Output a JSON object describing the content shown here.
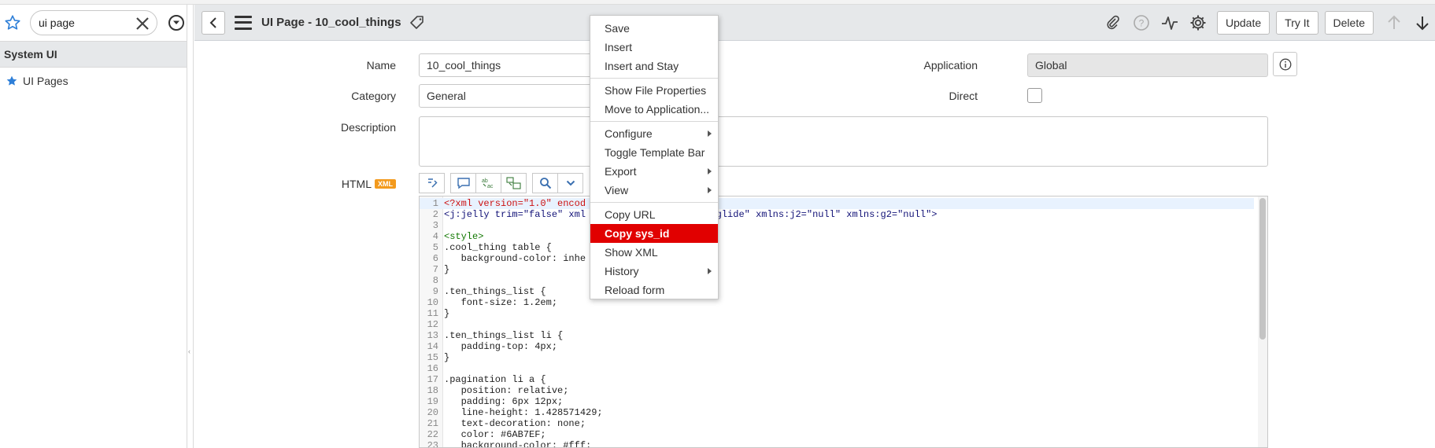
{
  "navigator": {
    "search_value": "ui page",
    "section_title": "System UI",
    "items": [
      {
        "label": "UI Pages"
      }
    ]
  },
  "header": {
    "title": "UI Page - 10_cool_things",
    "buttons": {
      "update": "Update",
      "try_it": "Try It",
      "delete": "Delete"
    }
  },
  "form": {
    "name": {
      "label": "Name",
      "value": "10_cool_things"
    },
    "category": {
      "label": "Category",
      "value": "General"
    },
    "description": {
      "label": "Description",
      "value": ""
    },
    "application": {
      "label": "Application",
      "value": "Global"
    },
    "direct": {
      "label": "Direct",
      "checked": false
    },
    "html": {
      "label": "HTML",
      "badge": "XML"
    }
  },
  "code": {
    "lines": [
      {
        "n": "1",
        "text": "<?xml version=\"1.0\" encod",
        "kind": "xmldecl",
        "active": true
      },
      {
        "n": "2",
        "text": "<j:jelly trim=\"false\" xml                   :g=\"glide\" xmlns:j2=\"null\" xmlns:g2=\"null\">",
        "kind": "jelly"
      },
      {
        "n": "3",
        "text": "",
        "kind": "plain"
      },
      {
        "n": "4",
        "text": "<style>",
        "kind": "tag"
      },
      {
        "n": "5",
        "text": ".cool_thing table {",
        "kind": "plain"
      },
      {
        "n": "6",
        "text": "   background-color: inhe",
        "kind": "plain"
      },
      {
        "n": "7",
        "text": "}",
        "kind": "plain"
      },
      {
        "n": "8",
        "text": "",
        "kind": "plain"
      },
      {
        "n": "9",
        "text": ".ten_things_list {",
        "kind": "plain"
      },
      {
        "n": "10",
        "text": "   font-size: 1.2em;",
        "kind": "plain"
      },
      {
        "n": "11",
        "text": "}",
        "kind": "plain"
      },
      {
        "n": "12",
        "text": "",
        "kind": "plain"
      },
      {
        "n": "13",
        "text": ".ten_things_list li {",
        "kind": "plain"
      },
      {
        "n": "14",
        "text": "   padding-top: 4px;",
        "kind": "plain"
      },
      {
        "n": "15",
        "text": "}",
        "kind": "plain"
      },
      {
        "n": "16",
        "text": "",
        "kind": "plain"
      },
      {
        "n": "17",
        "text": ".pagination li a {",
        "kind": "plain"
      },
      {
        "n": "18",
        "text": "   position: relative;",
        "kind": "plain"
      },
      {
        "n": "19",
        "text": "   padding: 6px 12px;",
        "kind": "plain"
      },
      {
        "n": "20",
        "text": "   line-height: 1.428571429;",
        "kind": "plain"
      },
      {
        "n": "21",
        "text": "   text-decoration: none;",
        "kind": "plain"
      },
      {
        "n": "22",
        "text": "   color: #6AB7EF;",
        "kind": "plain"
      },
      {
        "n": "23",
        "text": "   background-color: #fff;",
        "kind": "plain"
      }
    ]
  },
  "context_menu": {
    "items": [
      {
        "label": "Save"
      },
      {
        "label": "Insert"
      },
      {
        "label": "Insert and Stay"
      },
      {
        "sep": true
      },
      {
        "label": "Show File Properties"
      },
      {
        "label": "Move to Application..."
      },
      {
        "sep": true
      },
      {
        "label": "Configure",
        "submenu": true
      },
      {
        "label": "Toggle Template Bar"
      },
      {
        "label": "Export",
        "submenu": true
      },
      {
        "label": "View",
        "submenu": true
      },
      {
        "sep": true
      },
      {
        "label": "Copy URL"
      },
      {
        "label": "Copy sys_id",
        "selected": true
      },
      {
        "label": "Show XML"
      },
      {
        "label": "History",
        "submenu": true
      },
      {
        "label": "Reload form"
      }
    ]
  },
  "colors": {
    "accent": "#e10000",
    "header_bg": "#e6e8ea",
    "star": "#2e7fd8",
    "xml_badge": "#f39a1d"
  }
}
